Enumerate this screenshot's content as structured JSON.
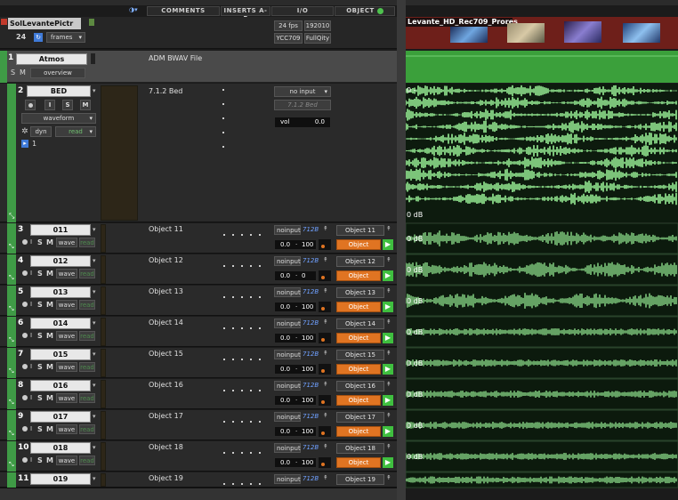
{
  "header": {
    "columns": [
      "COMMENTS",
      "INSERTS A-E",
      "I/O",
      "OBJECT"
    ]
  },
  "video_track": {
    "name": "SolLevantePictr",
    "fps_value": "24",
    "frames_label": "frames",
    "fps_button": "24 fps",
    "res_button": "192010",
    "ycc_button": "YCC709",
    "full_qty_button": "FullQity",
    "clip_name": "Levante_HD_Rec709_Prores"
  },
  "atmos_track": {
    "number": "1",
    "name": "Atmos",
    "s_label": "S",
    "m_label": "M",
    "view_label": "overview",
    "comment": "ADM BWAV File"
  },
  "bed_track": {
    "number": "2",
    "name": "BED",
    "i_label": "I",
    "s_label": "S",
    "m_label": "M",
    "view_label": "waveform",
    "dyn_label": "dyn",
    "read_label": "read",
    "one_label": "1",
    "comment": "7.1.2 Bed",
    "input_label": "no input",
    "output_label": "7.1.2 Bed",
    "vol_label": "vol",
    "vol_value": "0.0",
    "zero_db": "0 dB"
  },
  "object_tracks": [
    {
      "number": "3",
      "name": "011",
      "comment": "Object 11",
      "obj_name": "Object 11",
      "pan_value": "0.0",
      "pan_pos": "100"
    },
    {
      "number": "4",
      "name": "012",
      "comment": "Object 12",
      "obj_name": "Object 12",
      "pan_value": "0.0",
      "pan_pos": "0"
    },
    {
      "number": "5",
      "name": "013",
      "comment": "Object 13",
      "obj_name": "Object 13",
      "pan_value": "0.0",
      "pan_pos": "100"
    },
    {
      "number": "6",
      "name": "014",
      "comment": "Object 14",
      "obj_name": "Object 14",
      "pan_value": "0.0",
      "pan_pos": "100"
    },
    {
      "number": "7",
      "name": "015",
      "comment": "Object 15",
      "obj_name": "Object 15",
      "pan_value": "0.0",
      "pan_pos": "100"
    },
    {
      "number": "8",
      "name": "016",
      "comment": "Object 16",
      "obj_name": "Object 16",
      "pan_value": "0.0",
      "pan_pos": "100"
    },
    {
      "number": "9",
      "name": "017",
      "comment": "Object 17",
      "obj_name": "Object 17",
      "pan_value": "0.0",
      "pan_pos": "100"
    },
    {
      "number": "10",
      "name": "018",
      "comment": "Object 18",
      "obj_name": "Object 18",
      "pan_value": "0.0",
      "pan_pos": "100"
    },
    {
      "number": "11",
      "name": "019",
      "comment": "Object 19",
      "obj_name": "Object 19",
      "pan_value": "",
      "pan_pos": ""
    }
  ],
  "object_common": {
    "s_label": "S",
    "m_label": "M",
    "wave_label": "wave",
    "read_label": "read",
    "input_label": "noinput",
    "output_label": "712B",
    "object_button": "Object",
    "zero_db": "0 dB"
  },
  "colors": {
    "waveform": "#7cc47a",
    "track_tab": "#3f9b46",
    "object_orange": "#e07422",
    "output_blue": "#6fa0ff"
  }
}
